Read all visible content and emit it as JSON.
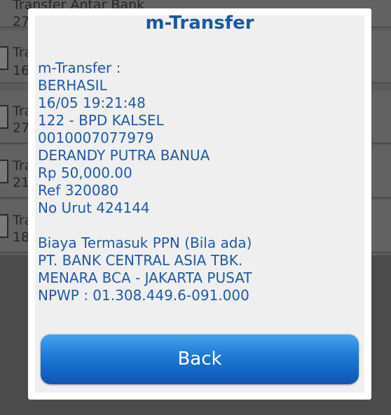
{
  "background": {
    "items": [
      {
        "line1": "Transfer Antar Bank",
        "line2": "27"
      },
      {
        "line1": "Tra",
        "line2": "16"
      },
      {
        "line1": "Tra",
        "line2": "27"
      },
      {
        "line1": "Tra",
        "line2": "21"
      },
      {
        "line1": "Tra",
        "line2": "18"
      }
    ]
  },
  "dialog": {
    "title": "m-Transfer",
    "lines": [
      "m-Transfer :",
      "BERHASIL",
      "16/05 19:21:48",
      "122 - BPD KALSEL",
      "0010007077979",
      "DERANDY PUTRA BANUA",
      "Rp 50,000.00",
      "Ref 320080",
      "No Urut 424144",
      "",
      "Biaya Termasuk PPN (Bila ada)",
      "PT. BANK CENTRAL ASIA TBK.",
      "MENARA BCA - JAKARTA PUSAT",
      "NPWP : 01.308.449.6-091.000"
    ],
    "back_label": "Back"
  }
}
